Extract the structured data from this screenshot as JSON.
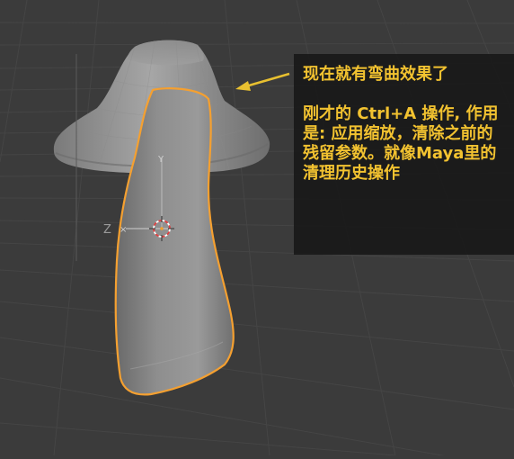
{
  "viewport": {
    "background": "#3b3b3b",
    "grid_color": "#454545",
    "selection_outline_color": "#f5a030",
    "mesh_color": "#8a8a8a",
    "axis_label": "Z",
    "axis_label_color": "#9a9a9a",
    "gizmo_label": "Y"
  },
  "note": {
    "text_color": "#f2c230",
    "arrow_color": "#e8c030",
    "line1": "现在就有弯曲效果了",
    "body": "刚才的 Ctrl+A 操作, 作用是: 应用缩放，清除之前的残留参数。就像Maya里的清理历史操作"
  }
}
